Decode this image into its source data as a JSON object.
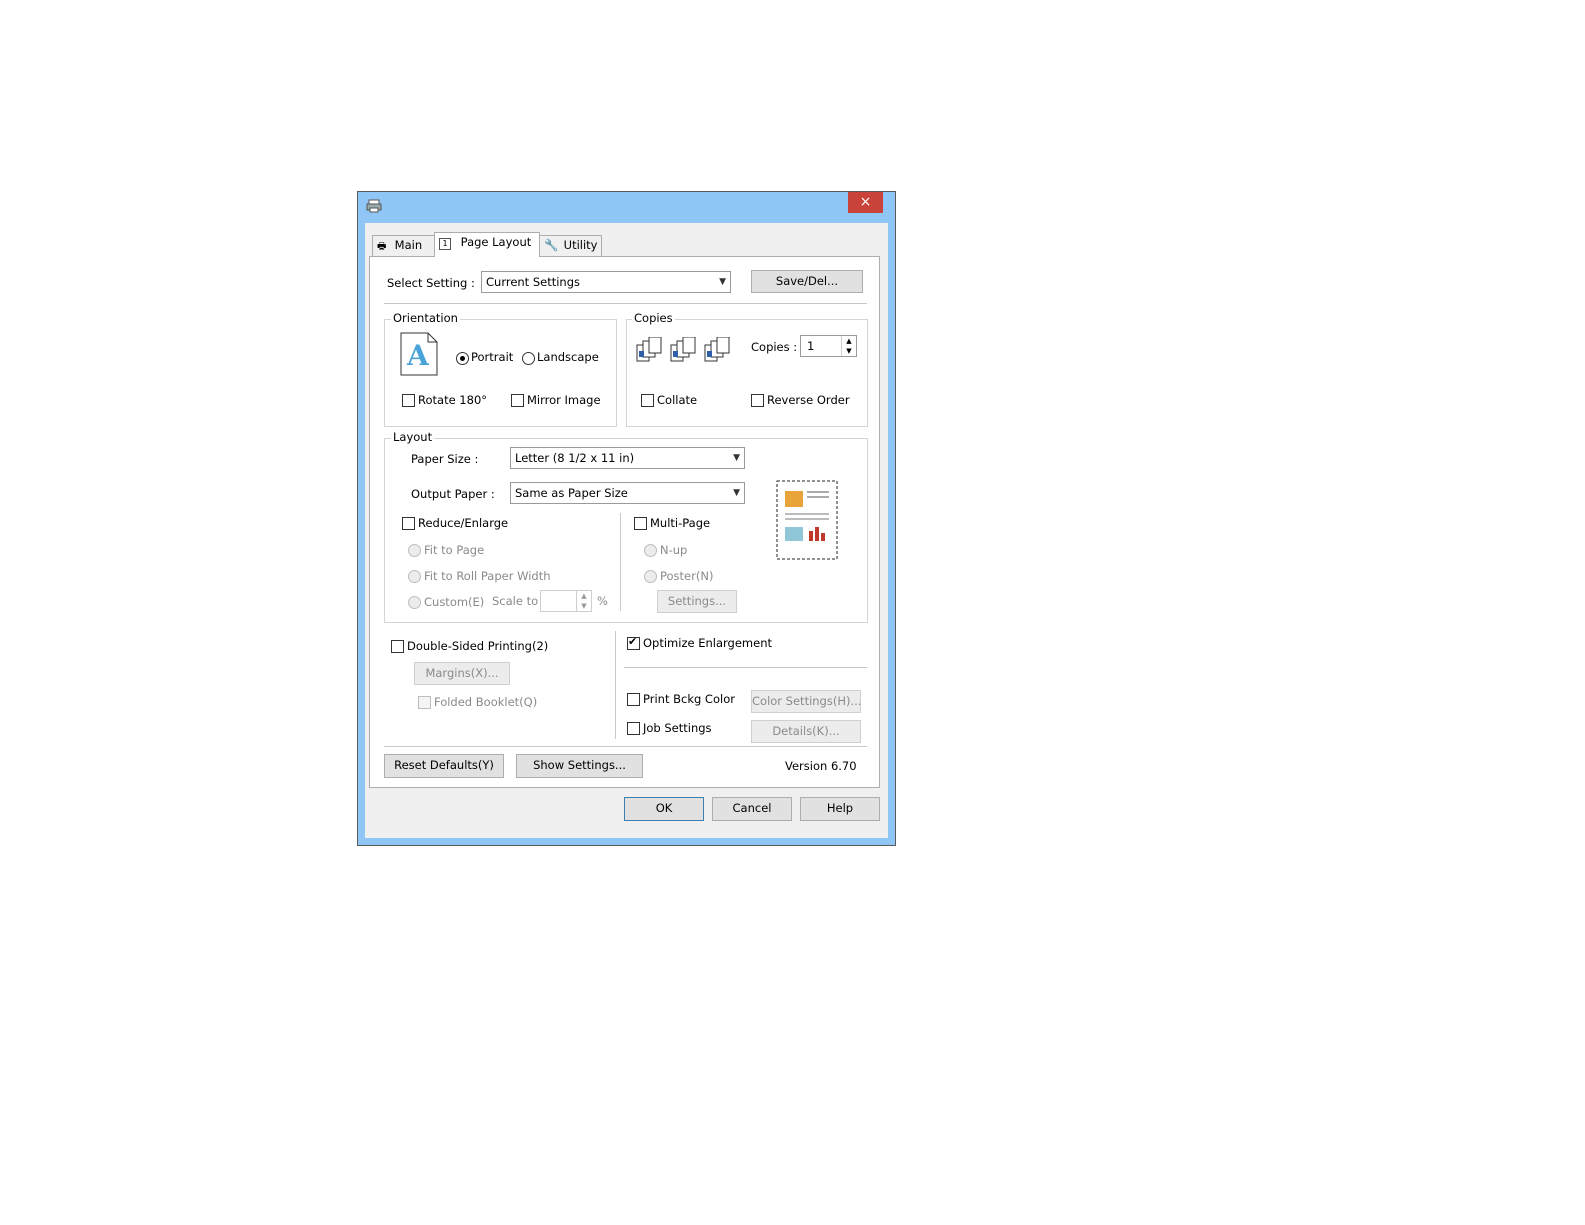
{
  "dialog": {
    "close_icon": "×",
    "printer_icon": "printer-icon"
  },
  "tabs": [
    {
      "label": "Main"
    },
    {
      "label": "Page Layout"
    },
    {
      "label": "Utility"
    }
  ],
  "select_setting": {
    "label": "Select Setting :",
    "value": "Current Settings",
    "save_button": "Save/Del..."
  },
  "orientation": {
    "legend": "Orientation",
    "portrait": "Portrait",
    "landscape": "Landscape",
    "rotate": "Rotate 180°",
    "mirror": "Mirror Image",
    "selected": "Portrait"
  },
  "copies": {
    "legend": "Copies",
    "copies_label": "Copies :",
    "copies_value": "1",
    "collate": "Collate",
    "reverse": "Reverse Order"
  },
  "layout": {
    "legend": "Layout",
    "paper_size_label": "Paper Size :",
    "paper_size_value": "Letter (8 1/2 x 11 in)",
    "output_paper_label": "Output Paper :",
    "output_paper_value": "Same as Paper Size",
    "reduce_enlarge": "Reduce/Enlarge",
    "fit_to_page": "Fit to Page",
    "fit_to_roll": "Fit to Roll Paper Width",
    "custom": "Custom(E)",
    "scale_to": "Scale to",
    "percent": "%",
    "multi_page": "Multi-Page",
    "n_up": "N-up",
    "poster": "Poster(N)",
    "settings_button": "Settings..."
  },
  "double_sided": {
    "label": "Double-Sided Printing(2)",
    "margins_button": "Margins(X)...",
    "folded_booklet": "Folded Booklet(Q)"
  },
  "options": {
    "optimize": "Optimize Enlargement",
    "optimize_checked": true,
    "print_bckg": "Print Bckg Color",
    "color_settings_button": "Color Settings(H)...",
    "job_settings": "Job Settings",
    "details_button": "Details(K)..."
  },
  "footer": {
    "reset_button": "Reset Defaults(Y)",
    "show_settings_button": "Show Settings...",
    "version": "Version 6.70"
  },
  "buttons": {
    "ok": "OK",
    "cancel": "Cancel",
    "help": "Help"
  }
}
